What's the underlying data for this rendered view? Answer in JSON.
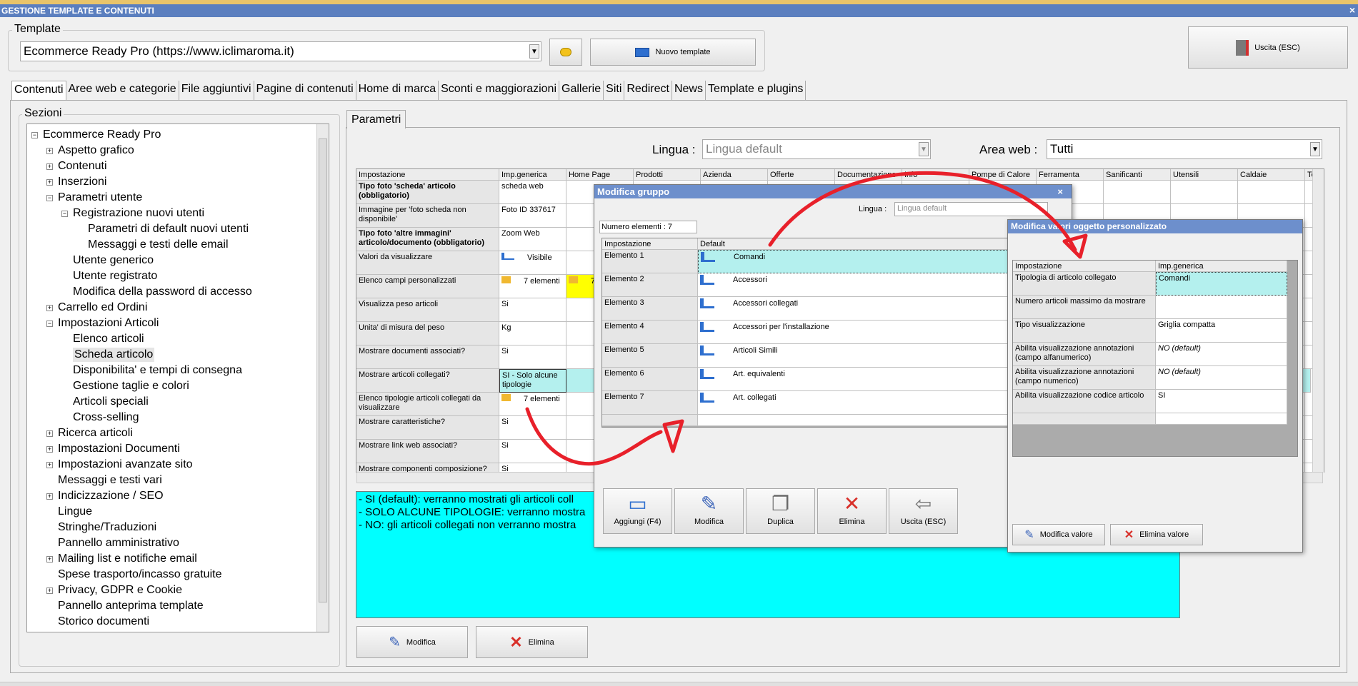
{
  "window": {
    "title": "GESTIONE TEMPLATE E CONTENUTI",
    "close": "×"
  },
  "template": {
    "label": "Template",
    "value": "Ecommerce Ready Pro (https://www.iclimaroma.it)",
    "new_button": "Nuovo template"
  },
  "exit_button": "Uscita (ESC)",
  "tabs": [
    "Contenuti",
    "Aree web e categorie",
    "File aggiuntivi",
    "Pagine di contenuti",
    "Home di marca",
    "Sconti e maggiorazioni",
    "Gallerie",
    "Siti",
    "Redirect",
    "News",
    "Template e plugins"
  ],
  "sections": {
    "label": "Sezioni",
    "tree": [
      {
        "t": "Ecommerce Ready Pro",
        "lvl": 0,
        "pm": "−"
      },
      {
        "t": "Aspetto grafico",
        "lvl": 1,
        "pm": "+"
      },
      {
        "t": "Contenuti",
        "lvl": 1,
        "pm": "+"
      },
      {
        "t": "Inserzioni",
        "lvl": 1,
        "pm": "+"
      },
      {
        "t": "Parametri utente",
        "lvl": 1,
        "pm": "−"
      },
      {
        "t": "Registrazione nuovi utenti",
        "lvl": 2,
        "pm": "−"
      },
      {
        "t": "Parametri di default nuovi utenti",
        "lvl": 3,
        "pm": ""
      },
      {
        "t": "Messaggi e testi delle email",
        "lvl": 3,
        "pm": ""
      },
      {
        "t": "Utente generico",
        "lvl": 2,
        "pm": ""
      },
      {
        "t": "Utente registrato",
        "lvl": 2,
        "pm": ""
      },
      {
        "t": "Modifica della password di accesso",
        "lvl": 2,
        "pm": ""
      },
      {
        "t": "Carrello ed Ordini",
        "lvl": 1,
        "pm": "+"
      },
      {
        "t": "Impostazioni Articoli",
        "lvl": 1,
        "pm": "−"
      },
      {
        "t": "Elenco articoli",
        "lvl": 2,
        "pm": ""
      },
      {
        "t": "Scheda articolo",
        "lvl": 2,
        "pm": "",
        "sel": true
      },
      {
        "t": "Disponibilita' e tempi di consegna",
        "lvl": 2,
        "pm": ""
      },
      {
        "t": "Gestione taglie e colori",
        "lvl": 2,
        "pm": ""
      },
      {
        "t": "Articoli speciali",
        "lvl": 2,
        "pm": ""
      },
      {
        "t": "Cross-selling",
        "lvl": 2,
        "pm": ""
      },
      {
        "t": "Ricerca articoli",
        "lvl": 1,
        "pm": "+"
      },
      {
        "t": "Impostazioni Documenti",
        "lvl": 1,
        "pm": "+"
      },
      {
        "t": "Impostazioni avanzate sito",
        "lvl": 1,
        "pm": "+"
      },
      {
        "t": "Messaggi e testi vari",
        "lvl": 1,
        "pm": ""
      },
      {
        "t": "Indicizzazione / SEO",
        "lvl": 1,
        "pm": "+"
      },
      {
        "t": "Lingue",
        "lvl": 1,
        "pm": ""
      },
      {
        "t": "Stringhe/Traduzioni",
        "lvl": 1,
        "pm": ""
      },
      {
        "t": "Pannello amministrativo",
        "lvl": 1,
        "pm": ""
      },
      {
        "t": "Mailing list e notifiche email",
        "lvl": 1,
        "pm": "+"
      },
      {
        "t": "Spese trasporto/incasso gratuite",
        "lvl": 1,
        "pm": ""
      },
      {
        "t": "Privacy, GDPR e Cookie",
        "lvl": 1,
        "pm": "+"
      },
      {
        "t": "Pannello anteprima template",
        "lvl": 1,
        "pm": ""
      },
      {
        "t": "Storico documenti",
        "lvl": 1,
        "pm": ""
      }
    ]
  },
  "params": {
    "tab": "Parametri",
    "lingua_label": "Lingua :",
    "lingua_value": "Lingua default",
    "area_label": "Area web :",
    "area_value": "Tutti",
    "columns": [
      "Impostazione",
      "Imp.generica",
      "Home Page",
      "Prodotti",
      "Azienda",
      "Offerte",
      "Documentazione",
      "Info",
      "Pompe di Calore",
      "Ferramenta",
      "Sanificanti",
      "Utensili",
      "Caldaie",
      "Ter"
    ],
    "rows": [
      {
        "k": "Tipo foto 'scheda' articolo (obbligatorio)",
        "v": "scheda web",
        "b": true
      },
      {
        "k": "Immagine per 'foto scheda non disponibile'",
        "v": "Foto ID 337617"
      },
      {
        "k": "Tipo foto 'altre immagini' articolo/documento (obbligatorio)",
        "v": "Zoom Web",
        "b": true
      },
      {
        "k": "Valori da visualizzare",
        "v": "Visibile"
      },
      {
        "k": "Elenco campi personalizzati",
        "v": "7 elementi"
      },
      {
        "k": "Visualizza peso articoli",
        "v": "Si"
      },
      {
        "k": "Unita' di misura del peso",
        "v": "Kg"
      },
      {
        "k": "Mostrare documenti associati?",
        "v": "Si"
      },
      {
        "k": "Mostrare articoli collegati?",
        "v": "SI - Solo alcune tipologie"
      },
      {
        "k": "Elenco tipologie articoli collegati da visualizzare",
        "v": "7 elementi"
      },
      {
        "k": "Mostrare caratteristiche?",
        "v": "Si"
      },
      {
        "k": "Mostrare link web associati?",
        "v": "Si"
      },
      {
        "k": "Mostrare componenti composizione?",
        "v": "Si"
      }
    ],
    "yellow_cell": "7",
    "description": [
      "- SI (default): verranno mostrati gli articoli coll",
      "- SOLO ALCUNE TIPOLOGIE: verranno mostra",
      "- NO: gli articoli collegati non verranno mostra"
    ],
    "edit_button": "Modifica",
    "delete_button": "Elimina"
  },
  "dlg_group": {
    "title": "Modifica gruppo",
    "close": "×",
    "lingua_label": "Lingua :",
    "lingua_value": "Lingua default",
    "count": "Numero elementi : 7",
    "columns": [
      "Impostazione",
      "Default"
    ],
    "rows": [
      {
        "k": "Elemento 1",
        "v": "Comandi"
      },
      {
        "k": "Elemento 2",
        "v": "Accessori"
      },
      {
        "k": "Elemento 3",
        "v": "Accessori collegati"
      },
      {
        "k": "Elemento 4",
        "v": "Accessori per l'installazione"
      },
      {
        "k": "Elemento 5",
        "v": "Articoli Simili"
      },
      {
        "k": "Elemento 6",
        "v": "Art. equivalenti"
      },
      {
        "k": "Elemento 7",
        "v": "Art. collegati"
      }
    ],
    "buttons": [
      "Aggiungi (F4)",
      "Modifica",
      "Duplica",
      "Elimina",
      "Uscita (ESC)"
    ]
  },
  "dlg_values": {
    "title": "Modifica valori oggetto personalizzato",
    "columns": [
      "Impostazione",
      "Imp.generica"
    ],
    "rows": [
      {
        "k": "Tipologia di articolo collegato",
        "v": "Comandi"
      },
      {
        "k": "Numero articoli massimo da mostrare",
        "v": ""
      },
      {
        "k": "Tipo visualizzazione",
        "v": "Griglia compatta"
      },
      {
        "k": "Abilita visualizzazione annotazioni (campo alfanumerico)",
        "v": "NO (default)",
        "i": true
      },
      {
        "k": "Abilita visualizzazione annotazioni (campo numerico)",
        "v": "NO (default)",
        "i": true
      },
      {
        "k": "Abilita visualizzazione codice articolo",
        "v": "SI"
      }
    ],
    "edit_button": "Modifica valore",
    "delete_button": "Elimina valore"
  },
  "colors": {
    "accent": "#6d8fcc",
    "cyan": "#00ffff",
    "sel_row": "#b4f0ee",
    "annotation": "#e8202a",
    "yellow": "#ffff00"
  }
}
